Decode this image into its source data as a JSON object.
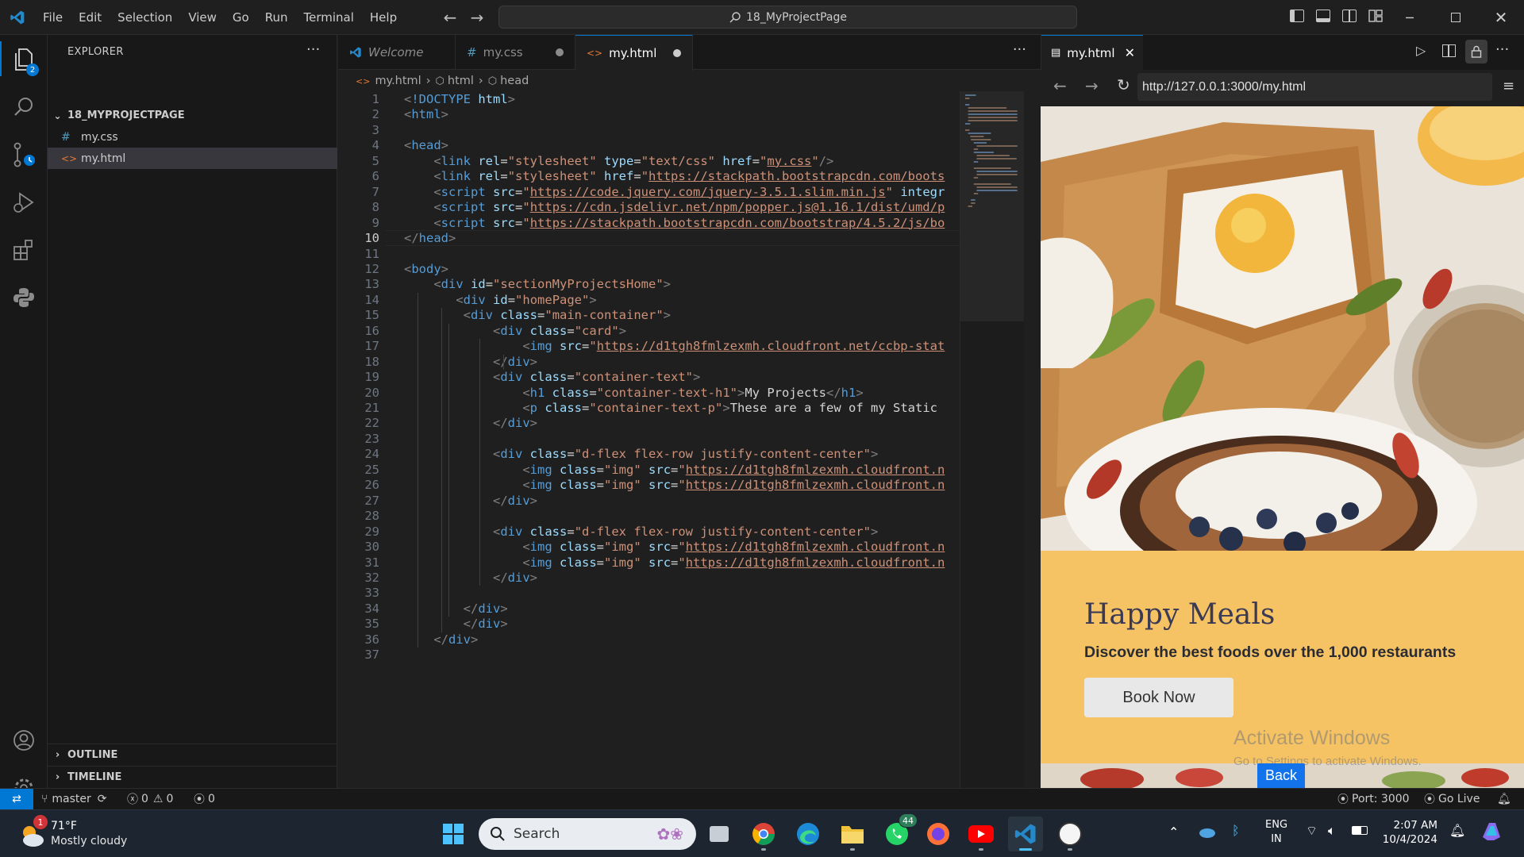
{
  "titlebar": {
    "menus": [
      "File",
      "Edit",
      "Selection",
      "View",
      "Go",
      "Run",
      "Terminal",
      "Help"
    ],
    "search": "18_MyProjectPage"
  },
  "activity_bar": {
    "explorer_badge": "2",
    "icons": [
      "files-icon",
      "search-icon",
      "source-control-icon",
      "run-debug-icon",
      "extensions-icon",
      "python-icon",
      "account-icon",
      "settings-icon"
    ]
  },
  "sidebar": {
    "title": "EXPLORER",
    "folder": "18_MYPROJECTPAGE",
    "files": [
      {
        "icon": "#",
        "name": "my.css"
      },
      {
        "icon": "<>",
        "name": "my.html"
      }
    ],
    "outline": "OUTLINE",
    "timeline": "TIMELINE"
  },
  "editor": {
    "tabs": [
      {
        "label": "Welcome"
      },
      {
        "label": "my.css"
      },
      {
        "label": "my.html"
      }
    ],
    "breadcrumb": [
      "my.html",
      "html",
      "head"
    ],
    "active_line": 10,
    "lines": [
      [
        [
          "t-punc",
          "<"
        ],
        [
          "t-tag",
          "!DOCTYPE"
        ],
        [
          "t-txt",
          " "
        ],
        [
          "t-attr",
          "html"
        ],
        [
          "t-punc",
          ">"
        ]
      ],
      [
        [
          "t-punc",
          "<"
        ],
        [
          "t-tag",
          "html"
        ],
        [
          "t-punc",
          ">"
        ]
      ],
      [],
      [
        [
          "t-punc",
          "<"
        ],
        [
          "t-tag",
          "head"
        ],
        [
          "t-punc",
          ">"
        ]
      ],
      [
        [
          "t-txt",
          "    "
        ],
        [
          "t-punc",
          "<"
        ],
        [
          "t-tag",
          "link"
        ],
        [
          "t-txt",
          " "
        ],
        [
          "t-attr",
          "rel"
        ],
        [
          "t-txt",
          "="
        ],
        [
          "t-str",
          "\"stylesheet\""
        ],
        [
          "t-txt",
          " "
        ],
        [
          "t-attr",
          "type"
        ],
        [
          "t-txt",
          "="
        ],
        [
          "t-str",
          "\"text/css\""
        ],
        [
          "t-txt",
          " "
        ],
        [
          "t-attr",
          "href"
        ],
        [
          "t-txt",
          "="
        ],
        [
          "t-str",
          "\""
        ],
        [
          "t-link",
          "my.css"
        ],
        [
          "t-str",
          "\""
        ],
        [
          "t-punc",
          "/>"
        ]
      ],
      [
        [
          "t-txt",
          "    "
        ],
        [
          "t-punc",
          "<"
        ],
        [
          "t-tag",
          "link"
        ],
        [
          "t-txt",
          " "
        ],
        [
          "t-attr",
          "rel"
        ],
        [
          "t-txt",
          "="
        ],
        [
          "t-str",
          "\"stylesheet\""
        ],
        [
          "t-txt",
          " "
        ],
        [
          "t-attr",
          "href"
        ],
        [
          "t-txt",
          "="
        ],
        [
          "t-str",
          "\""
        ],
        [
          "t-link",
          "https://stackpath.bootstrapcdn.com/boots"
        ]
      ],
      [
        [
          "t-txt",
          "    "
        ],
        [
          "t-punc",
          "<"
        ],
        [
          "t-tag",
          "script"
        ],
        [
          "t-txt",
          " "
        ],
        [
          "t-attr",
          "src"
        ],
        [
          "t-txt",
          "="
        ],
        [
          "t-str",
          "\""
        ],
        [
          "t-link",
          "https://code.jquery.com/jquery-3.5.1.slim.min.js"
        ],
        [
          "t-str",
          "\""
        ],
        [
          "t-txt",
          " "
        ],
        [
          "t-attr",
          "integr"
        ]
      ],
      [
        [
          "t-txt",
          "    "
        ],
        [
          "t-punc",
          "<"
        ],
        [
          "t-tag",
          "script"
        ],
        [
          "t-txt",
          " "
        ],
        [
          "t-attr",
          "src"
        ],
        [
          "t-txt",
          "="
        ],
        [
          "t-str",
          "\""
        ],
        [
          "t-link",
          "https://cdn.jsdelivr.net/npm/popper.js@1.16.1/dist/umd/p"
        ]
      ],
      [
        [
          "t-txt",
          "    "
        ],
        [
          "t-punc",
          "<"
        ],
        [
          "t-tag",
          "script"
        ],
        [
          "t-txt",
          " "
        ],
        [
          "t-attr",
          "src"
        ],
        [
          "t-txt",
          "="
        ],
        [
          "t-str",
          "\""
        ],
        [
          "t-link",
          "https://stackpath.bootstrapcdn.com/bootstrap/4.5.2/js/bo"
        ]
      ],
      [
        [
          "t-punc",
          "</"
        ],
        [
          "t-tag",
          "head"
        ],
        [
          "t-punc",
          ">"
        ]
      ],
      [],
      [
        [
          "t-punc",
          "<"
        ],
        [
          "t-tag",
          "body"
        ],
        [
          "t-punc",
          ">"
        ]
      ],
      [
        [
          "t-txt",
          "    "
        ],
        [
          "t-punc",
          "<"
        ],
        [
          "t-tag",
          "div"
        ],
        [
          "t-txt",
          " "
        ],
        [
          "t-attr",
          "id"
        ],
        [
          "t-txt",
          "="
        ],
        [
          "t-str",
          "\"sectionMyProjectsHome\""
        ],
        [
          "t-punc",
          ">"
        ]
      ],
      [
        [
          "t-txt",
          "       "
        ],
        [
          "t-punc",
          "<"
        ],
        [
          "t-tag",
          "div"
        ],
        [
          "t-txt",
          " "
        ],
        [
          "t-attr",
          "id"
        ],
        [
          "t-txt",
          "="
        ],
        [
          "t-str",
          "\"homePage\""
        ],
        [
          "t-punc",
          ">"
        ]
      ],
      [
        [
          "t-txt",
          "        "
        ],
        [
          "t-punc",
          "<"
        ],
        [
          "t-tag",
          "div"
        ],
        [
          "t-txt",
          " "
        ],
        [
          "t-attr",
          "class"
        ],
        [
          "t-txt",
          "="
        ],
        [
          "t-str",
          "\"main-container\""
        ],
        [
          "t-punc",
          ">"
        ]
      ],
      [
        [
          "t-txt",
          "            "
        ],
        [
          "t-punc",
          "<"
        ],
        [
          "t-tag",
          "div"
        ],
        [
          "t-txt",
          " "
        ],
        [
          "t-attr",
          "class"
        ],
        [
          "t-txt",
          "="
        ],
        [
          "t-str",
          "\"card\""
        ],
        [
          "t-punc",
          ">"
        ]
      ],
      [
        [
          "t-txt",
          "                "
        ],
        [
          "t-punc",
          "<"
        ],
        [
          "t-tag",
          "img"
        ],
        [
          "t-txt",
          " "
        ],
        [
          "t-attr",
          "src"
        ],
        [
          "t-txt",
          "="
        ],
        [
          "t-str",
          "\""
        ],
        [
          "t-link",
          "https://d1tgh8fmlzexmh.cloudfront.net/ccbp-stat"
        ]
      ],
      [
        [
          "t-txt",
          "            "
        ],
        [
          "t-punc",
          "</"
        ],
        [
          "t-tag",
          "div"
        ],
        [
          "t-punc",
          ">"
        ]
      ],
      [
        [
          "t-txt",
          "            "
        ],
        [
          "t-punc",
          "<"
        ],
        [
          "t-tag",
          "div"
        ],
        [
          "t-txt",
          " "
        ],
        [
          "t-attr",
          "class"
        ],
        [
          "t-txt",
          "="
        ],
        [
          "t-str",
          "\"container-text\""
        ],
        [
          "t-punc",
          ">"
        ]
      ],
      [
        [
          "t-txt",
          "                "
        ],
        [
          "t-punc",
          "<"
        ],
        [
          "t-tag",
          "h1"
        ],
        [
          "t-txt",
          " "
        ],
        [
          "t-attr",
          "class"
        ],
        [
          "t-txt",
          "="
        ],
        [
          "t-str",
          "\"container-text-h1\""
        ],
        [
          "t-punc",
          ">"
        ],
        [
          "t-txt",
          "My Projects"
        ],
        [
          "t-punc",
          "</"
        ],
        [
          "t-tag",
          "h1"
        ],
        [
          "t-punc",
          ">"
        ]
      ],
      [
        [
          "t-txt",
          "                "
        ],
        [
          "t-punc",
          "<"
        ],
        [
          "t-tag",
          "p"
        ],
        [
          "t-txt",
          " "
        ],
        [
          "t-attr",
          "class"
        ],
        [
          "t-txt",
          "="
        ],
        [
          "t-str",
          "\"container-text-p\""
        ],
        [
          "t-punc",
          ">"
        ],
        [
          "t-txt",
          "These are a few of my Static"
        ]
      ],
      [
        [
          "t-txt",
          "            "
        ],
        [
          "t-punc",
          "</"
        ],
        [
          "t-tag",
          "div"
        ],
        [
          "t-punc",
          ">"
        ]
      ],
      [],
      [
        [
          "t-txt",
          "            "
        ],
        [
          "t-punc",
          "<"
        ],
        [
          "t-tag",
          "div"
        ],
        [
          "t-txt",
          " "
        ],
        [
          "t-attr",
          "class"
        ],
        [
          "t-txt",
          "="
        ],
        [
          "t-str",
          "\"d-flex flex-row justify-content-center\""
        ],
        [
          "t-punc",
          ">"
        ]
      ],
      [
        [
          "t-txt",
          "                "
        ],
        [
          "t-punc",
          "<"
        ],
        [
          "t-tag",
          "img"
        ],
        [
          "t-txt",
          " "
        ],
        [
          "t-attr",
          "class"
        ],
        [
          "t-txt",
          "="
        ],
        [
          "t-str",
          "\"img\""
        ],
        [
          "t-txt",
          " "
        ],
        [
          "t-attr",
          "src"
        ],
        [
          "t-txt",
          "="
        ],
        [
          "t-str",
          "\""
        ],
        [
          "t-link",
          "https://d1tgh8fmlzexmh.cloudfront.n"
        ]
      ],
      [
        [
          "t-txt",
          "                "
        ],
        [
          "t-punc",
          "<"
        ],
        [
          "t-tag",
          "img"
        ],
        [
          "t-txt",
          " "
        ],
        [
          "t-attr",
          "class"
        ],
        [
          "t-txt",
          "="
        ],
        [
          "t-str",
          "\"img\""
        ],
        [
          "t-txt",
          " "
        ],
        [
          "t-attr",
          "src"
        ],
        [
          "t-txt",
          "="
        ],
        [
          "t-str",
          "\""
        ],
        [
          "t-link",
          "https://d1tgh8fmlzexmh.cloudfront.n"
        ]
      ],
      [
        [
          "t-txt",
          "            "
        ],
        [
          "t-punc",
          "</"
        ],
        [
          "t-tag",
          "div"
        ],
        [
          "t-punc",
          ">"
        ]
      ],
      [],
      [
        [
          "t-txt",
          "            "
        ],
        [
          "t-punc",
          "<"
        ],
        [
          "t-tag",
          "div"
        ],
        [
          "t-txt",
          " "
        ],
        [
          "t-attr",
          "class"
        ],
        [
          "t-txt",
          "="
        ],
        [
          "t-str",
          "\"d-flex flex-row justify-content-center\""
        ],
        [
          "t-punc",
          ">"
        ]
      ],
      [
        [
          "t-txt",
          "                "
        ],
        [
          "t-punc",
          "<"
        ],
        [
          "t-tag",
          "img"
        ],
        [
          "t-txt",
          " "
        ],
        [
          "t-attr",
          "class"
        ],
        [
          "t-txt",
          "="
        ],
        [
          "t-str",
          "\"img\""
        ],
        [
          "t-txt",
          " "
        ],
        [
          "t-attr",
          "src"
        ],
        [
          "t-txt",
          "="
        ],
        [
          "t-str",
          "\""
        ],
        [
          "t-link",
          "https://d1tgh8fmlzexmh.cloudfront.n"
        ]
      ],
      [
        [
          "t-txt",
          "                "
        ],
        [
          "t-punc",
          "<"
        ],
        [
          "t-tag",
          "img"
        ],
        [
          "t-txt",
          " "
        ],
        [
          "t-attr",
          "class"
        ],
        [
          "t-txt",
          "="
        ],
        [
          "t-str",
          "\"img\""
        ],
        [
          "t-txt",
          " "
        ],
        [
          "t-attr",
          "src"
        ],
        [
          "t-txt",
          "="
        ],
        [
          "t-str",
          "\""
        ],
        [
          "t-link",
          "https://d1tgh8fmlzexmh.cloudfront.n"
        ]
      ],
      [
        [
          "t-txt",
          "            "
        ],
        [
          "t-punc",
          "</"
        ],
        [
          "t-tag",
          "div"
        ],
        [
          "t-punc",
          ">"
        ]
      ],
      [],
      [
        [
          "t-txt",
          "        "
        ],
        [
          "t-punc",
          "</"
        ],
        [
          "t-tag",
          "div"
        ],
        [
          "t-punc",
          ">"
        ]
      ],
      [
        [
          "t-txt",
          "        "
        ],
        [
          "t-punc",
          "</"
        ],
        [
          "t-tag",
          "div"
        ],
        [
          "t-punc",
          ">"
        ]
      ],
      [
        [
          "t-txt",
          "    "
        ],
        [
          "t-punc",
          "</"
        ],
        [
          "t-tag",
          "div"
        ],
        [
          "t-punc",
          ">"
        ]
      ],
      []
    ]
  },
  "browser": {
    "tab_label": "my.html",
    "url": "http://127.0.0.1:3000/my.html",
    "card_title": "Happy Meals",
    "card_subtitle": "Discover the best foods over the 1,000 restaurants",
    "book_button": "Book Now",
    "back_button": "Back",
    "activate_title": "Activate Windows",
    "activate_sub": "Go to Settings to activate Windows."
  },
  "statusbar": {
    "branch": "master",
    "errors": "0",
    "warnings": "0",
    "ports": "0",
    "port_text": "Port: 3000",
    "golive": "Go Live"
  },
  "taskbar": {
    "weather_temp": "71°F",
    "weather_desc": "Mostly cloudy",
    "weather_badge": "1",
    "search": "Search",
    "whatsapp_badge": "44",
    "lang1": "ENG",
    "lang2": "IN",
    "time": "2:07 AM",
    "date": "10/4/2024"
  },
  "colors": {
    "accent": "#0078d4",
    "card": "#f5c364",
    "back_button": "#1273ea"
  }
}
